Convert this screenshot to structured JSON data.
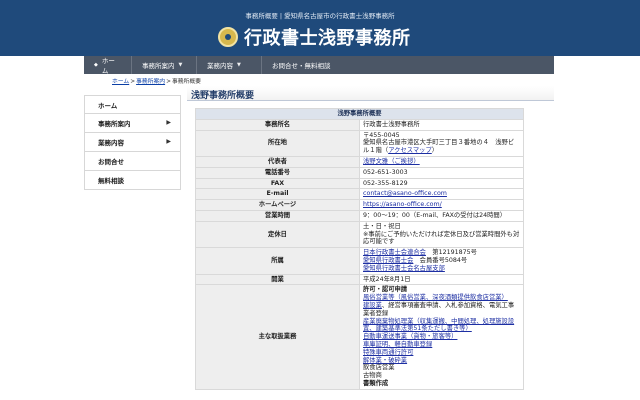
{
  "header": {
    "tagline": "事務所概要 | 愛知県名古屋市の行政書士浅野事務所",
    "title": "行政書士浅野事務所"
  },
  "nav": {
    "items": [
      {
        "label": "ホーム"
      },
      {
        "label": "事務所案内"
      },
      {
        "label": "業務内容"
      },
      {
        "label": "お問合せ・無料相談"
      }
    ]
  },
  "breadcrumb": {
    "home": "ホーム",
    "office_guide": "事務所案内",
    "current": "事務所概要"
  },
  "sidebar": {
    "items": [
      {
        "label": "ホーム"
      },
      {
        "label": "事務所案内"
      },
      {
        "label": "業務内容"
      },
      {
        "label": "お問合せ"
      },
      {
        "label": "無料相談"
      }
    ]
  },
  "main": {
    "page_title": "浅野事務所概要",
    "table_title": "浅野事務所概要",
    "rows": {
      "office_name_label": "事務所名",
      "office_name": "行政書士浅野事務所",
      "address_label": "所在地",
      "postal_code": "〒455-0045",
      "address": "愛知県名古屋市港区大手町三丁目３番地の４　浅野ビル１階（",
      "access_map": "アクセスマップ",
      "address_close": "）",
      "representative_label": "代表者",
      "representative": "浅野文雅（ご挨拶）",
      "phone_label": "電話番号",
      "phone": "052-651-3003",
      "fax_label": "FAX",
      "fax": "052-355-8129",
      "email_label": "E-mail",
      "email": "contact@asano-office.com",
      "homepage_label": "ホームページ",
      "homepage": "https://asano-office.com/",
      "hours_label": "営業時間",
      "hours": "9：00〜19：00（E-mail、FAXの受付は24時間）",
      "holidays_label": "定休日",
      "holidays": "土・日・祝日",
      "holidays_note": "※事前にご予約いただければ定休日及び営業時間外も対応可能です",
      "affiliations_label": "所属",
      "affiliation_1": "日本行政書士会連合会",
      "affiliation_1_number": "　第12191875号",
      "affiliation_2": "愛知県行政書士会",
      "affiliation_2_number": "　会員番号5084号",
      "affiliation_3": "愛知県行政書士会名古屋支部",
      "opened_label": "開業",
      "opened": "平成24年8月1日",
      "main_business_label": "主な取扱業務",
      "permits_heading": "許可・認可申請",
      "business_1": "風俗営業等（風俗営業、深夜酒類提供飲食店営業）",
      "business_2_link": "建設業",
      "business_2_rest": "、経営事項審査申請、入札参加資格、電気工事業者登録",
      "business_3": "産業廃棄物処理業（収集運搬、中間処理、処理施設設置、建築基準法第51条ただし書き等）",
      "business_4": "自動車運送事業（貨物・旅客等）",
      "business_5": "車庫証明、軽自動車登録",
      "business_6": "特殊車両通行許可",
      "business_7": "解体業・破砕業",
      "business_8": "飲食店営業",
      "business_9": "古物商",
      "documents_heading": "書類作成"
    }
  }
}
